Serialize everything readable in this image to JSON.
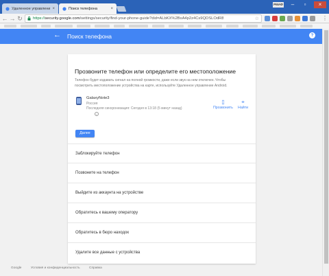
{
  "browser": {
    "tabs": [
      {
        "label": "Удаленное управлени"
      },
      {
        "label": "Поиск телефона"
      }
    ],
    "profile_badge": "РМАФ",
    "url": {
      "scheme": "https://",
      "host": "security.google.com",
      "path": "/settings/security/find-your-phone-guide?did=ALbKX%2BxA4p2z4Cs9QDSLOdR8"
    }
  },
  "appbar": {
    "title": "Поиск телефона",
    "back_icon": "arrow-left-icon",
    "help_icon": "help-icon"
  },
  "card": {
    "heading": "Прозвоните телефон или определите его местоположение",
    "description": "Телефон будет издавать сигнал на полной громкости, даже если звук на нем отключен. Чтобы посмотреть местоположение устройства на карте, используйте Удаленное управление Android.",
    "device": {
      "name": "GalaxyNote3",
      "country": "Россия",
      "sync": "Последняя синхронизация: Сегодня в 13:18 (5 минут назад)"
    },
    "actions": {
      "ring": "Прозвонить",
      "locate": "Найти"
    },
    "next_button": "Далее",
    "options": [
      "Заблокируйте телефон",
      "Позвоните на телефон",
      "Выйдите из аккаунта на устройстве",
      "Обратитесь к вашему оператору",
      "Обратитесь в бюро находок",
      "Удалите все данные с устройства"
    ]
  },
  "footer": {
    "links": [
      "Google",
      "Условия и конфиденциальность",
      "Справка"
    ]
  },
  "colors": {
    "accent": "#4285f4",
    "window": "#2b63b8"
  }
}
